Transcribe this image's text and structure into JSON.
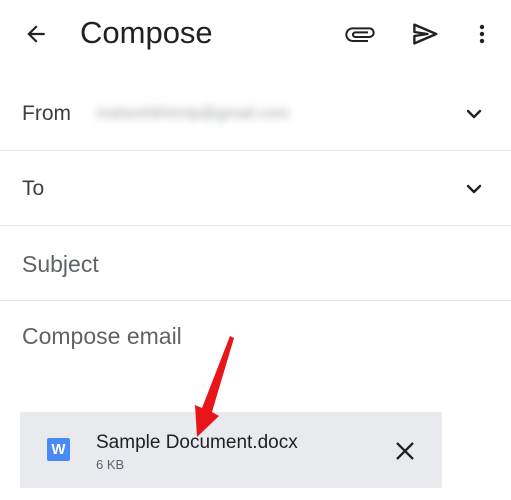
{
  "appbar": {
    "title": "Compose",
    "icons": {
      "back": "arrow-left-icon",
      "attach": "paperclip-icon",
      "send": "send-icon",
      "more": "more-vert-icon"
    }
  },
  "fields": {
    "from_label": "From",
    "from_value": "maheshkhinrip@gmail.com",
    "to_label": "To",
    "subject_placeholder": "Subject",
    "body_placeholder": "Compose email"
  },
  "attachment": {
    "icon_letter": "W",
    "name": "Sample Document.docx",
    "size": "6 KB"
  },
  "colors": {
    "annotation_arrow": "#e8151b",
    "word_icon": "#4a8af4",
    "chip_background": "#e8eaed"
  }
}
